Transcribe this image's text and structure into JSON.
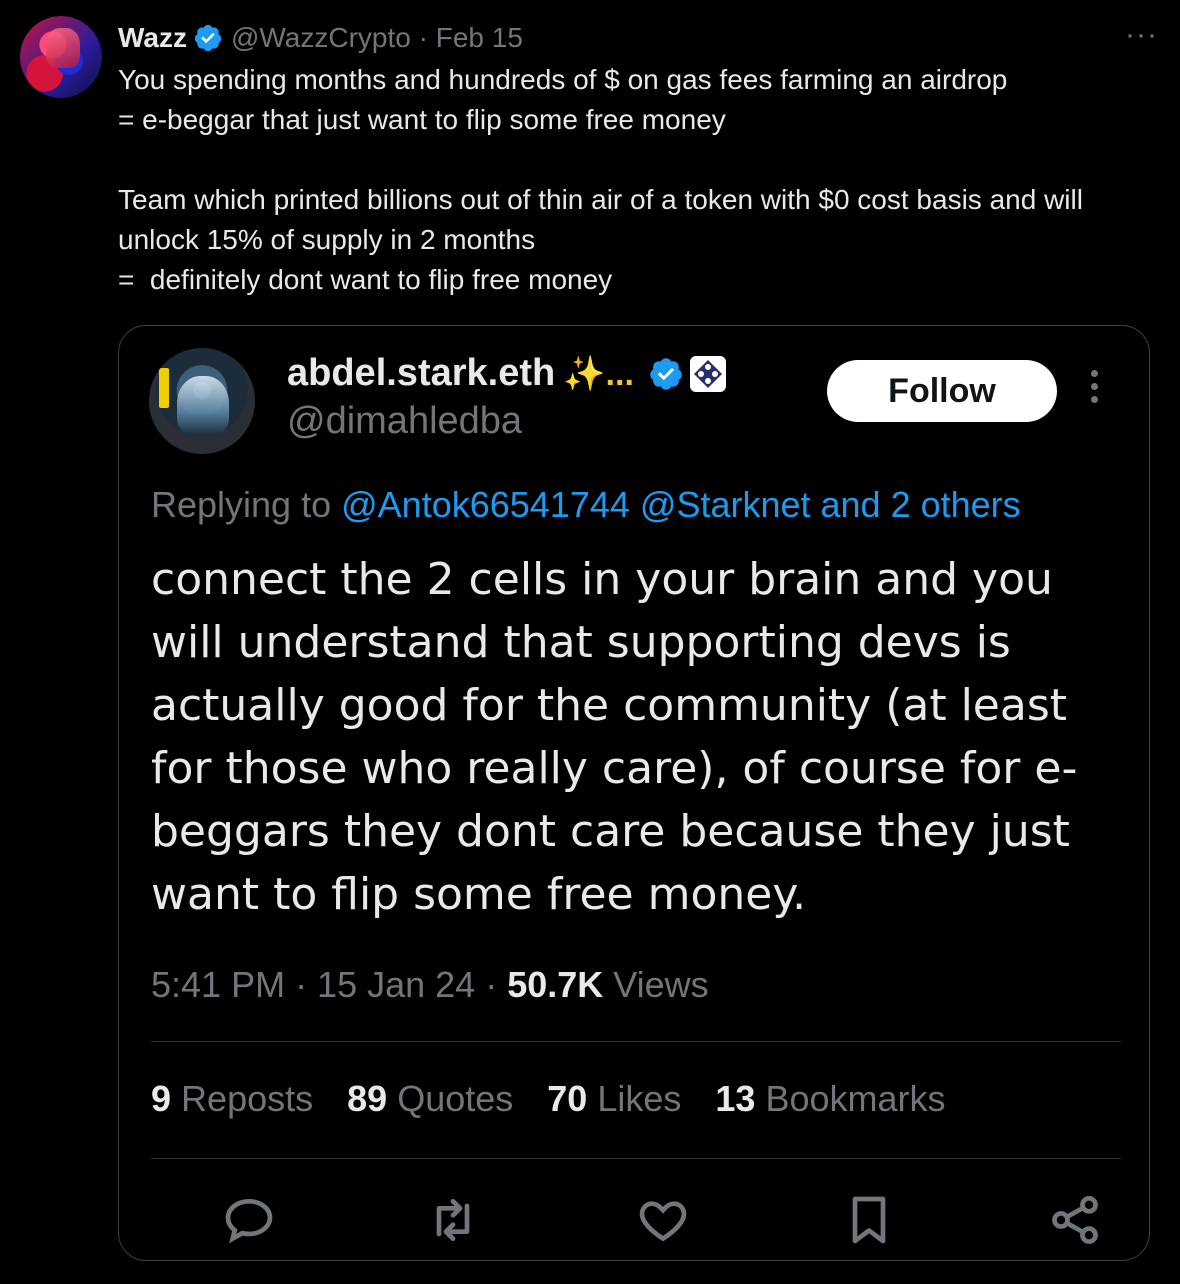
{
  "tweet": {
    "display_name": "Wazz",
    "handle": "@WazzCrypto",
    "sep": "·",
    "date": "Feb 15",
    "more": "···",
    "text": "You spending months and hundreds of $ on gas fees farming an airdrop\n= e-beggar that just want to flip some free money\n\nTeam which printed billions out of thin air of a token with $0 cost basis and will unlock 15% of supply in 2 months\n=  definitely dont want to flip free money"
  },
  "quote": {
    "display_name": "abdel.stark.eth",
    "name_suffix": "✨...",
    "handle": "@dimahledba",
    "follow_label": "Follow",
    "replying_prefix": "Replying to",
    "replying_links": "@Antok66541744 @Starknet and 2 others",
    "text": "connect the 2 cells in your brain and you will understand that supporting devs is actually good for the community (at least for those who really care), of course for e-beggars they dont care because they just want to flip some free money.",
    "time": "5:41 PM · 15 Jan 24 · ",
    "views_count": "50.7K",
    "views_label": "Views",
    "stats": [
      {
        "count": "9",
        "label": "Reposts"
      },
      {
        "count": "89",
        "label": "Quotes"
      },
      {
        "count": "70",
        "label": "Likes"
      },
      {
        "count": "13",
        "label": "Bookmarks"
      }
    ],
    "actions": [
      "reply-icon",
      "repost-icon",
      "like-icon",
      "bookmark-icon",
      "share-icon"
    ]
  },
  "colors": {
    "background": "#000000",
    "text": "#e7e9ea",
    "secondary": "#71767b",
    "link": "#1d9bf0",
    "verified": "#1d9bf0",
    "border": "#2f3336"
  }
}
